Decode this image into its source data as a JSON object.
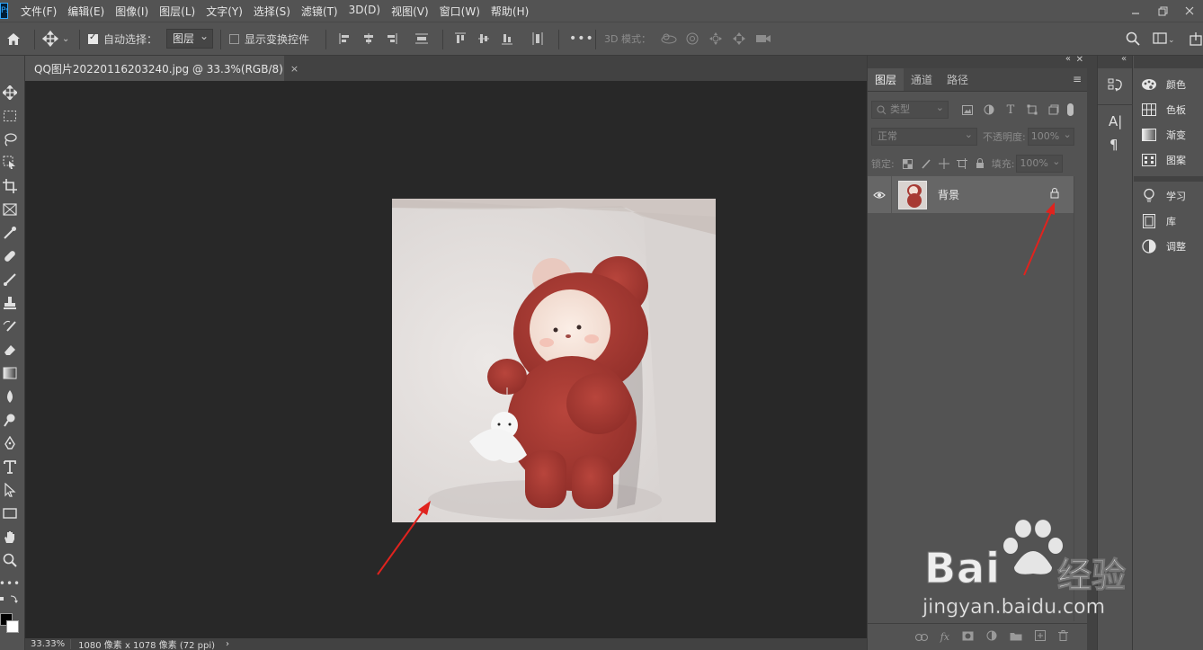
{
  "menubar": {
    "logo": "Ps",
    "items": [
      "文件(F)",
      "编辑(E)",
      "图像(I)",
      "图层(L)",
      "文字(Y)",
      "选择(S)",
      "滤镜(T)",
      "3D(D)",
      "视图(V)",
      "窗口(W)",
      "帮助(H)"
    ],
    "window_controls": [
      "minimize-icon",
      "restore-icon",
      "close-icon"
    ]
  },
  "options": {
    "home_icon": "home-icon",
    "move_icon": "move-tool-icon",
    "auto_select_label": "自动选择：",
    "auto_select_checked": true,
    "auto_select_target": "图层",
    "show_transform_label": "显示变换控件",
    "show_transform_checked": false,
    "more": "•••",
    "mode_3d_label": "3D 模式："
  },
  "document": {
    "tab_title": "QQ图片20220116203240.jpg @ 33.3%(RGB/8)",
    "tab_close": "×",
    "zoom": "33.33%",
    "info": "1080 像素 x 1078 像素 (72 ppi)",
    "info_arrow": "›"
  },
  "layers_panel": {
    "tabs": [
      "图层",
      "通道",
      "路径"
    ],
    "active_tab": "图层",
    "filter_kind": "类型",
    "blend_mode": "正常",
    "opacity_label": "不透明度:",
    "opacity_value": "100%",
    "lock_label": "锁定:",
    "fill_label": "填充:",
    "fill_value": "100%",
    "layers": [
      {
        "name": "背景",
        "visible": true,
        "locked": true
      }
    ],
    "bottom_icons": [
      "link-icon",
      "fx-icon",
      "mask-icon",
      "adjustment-icon",
      "group-icon",
      "new-layer-icon",
      "trash-icon"
    ]
  },
  "icon_strip": {
    "items": [
      "history-icon",
      "character-icon",
      "paragraph-icon"
    ],
    "character_glyph": "A|",
    "paragraph_glyph": "¶"
  },
  "right_panels": {
    "groups": [
      [
        {
          "label": "颜色",
          "icon": "palette-icon"
        },
        {
          "label": "色板",
          "icon": "swatches-icon"
        },
        {
          "label": "渐变",
          "icon": "gradient-icon"
        },
        {
          "label": "图案",
          "icon": "pattern-icon"
        }
      ],
      [
        {
          "label": "学习",
          "icon": "bulb-icon"
        },
        {
          "label": "库",
          "icon": "library-icon"
        },
        {
          "label": "调整",
          "icon": "adjust-icon"
        }
      ]
    ]
  },
  "watermark": {
    "brand": "Bai",
    "brand2": "du",
    "chinese": "经验",
    "url": "jingyan.baidu.com"
  },
  "colors": {
    "panel_bg": "#535353",
    "canvas_bg": "#282828",
    "arrow": "#e0231e",
    "plush_red": "#a73a34"
  }
}
